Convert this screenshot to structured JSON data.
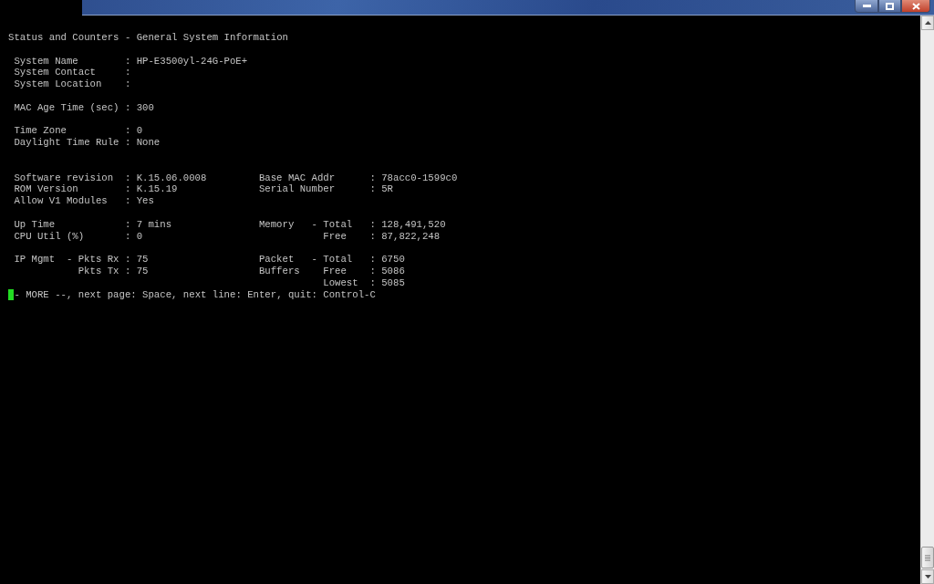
{
  "terminal": {
    "lines": [
      {
        "kind": "heading",
        "text": "Status and Counters - General System Information"
      },
      {
        "kind": "blank"
      },
      {
        "kind": "field",
        "left": {
          "label": "System Name",
          "sep": ":",
          "value": "HP-E3500yl-24G-PoE+"
        }
      },
      {
        "kind": "field",
        "left": {
          "label": "System Contact",
          "sep": ":"
        }
      },
      {
        "kind": "field",
        "left": {
          "label": "System Location",
          "sep": ":"
        }
      },
      {
        "kind": "blank"
      },
      {
        "kind": "field",
        "left": {
          "label": "MAC Age Time (sec)",
          "sep": ":",
          "value": "300"
        }
      },
      {
        "kind": "blank"
      },
      {
        "kind": "field",
        "left": {
          "label": "Time Zone",
          "sep": ":",
          "value": "0"
        }
      },
      {
        "kind": "field",
        "left": {
          "label": "Daylight Time Rule",
          "sep": ":",
          "value": "None"
        }
      },
      {
        "kind": "blank"
      },
      {
        "kind": "blank"
      },
      {
        "kind": "field",
        "left": {
          "label": "Software revision",
          "sep": ":",
          "value": "K.15.06.0008"
        },
        "right": {
          "label": "Base MAC Addr",
          "sep": ":",
          "value": "78acc0-1599c0"
        }
      },
      {
        "kind": "field",
        "left": {
          "label": "ROM Version",
          "sep": ":",
          "value": "K.15.19"
        },
        "right": {
          "label": "Serial Number",
          "sep": ":",
          "value": "5R"
        }
      },
      {
        "kind": "field",
        "left": {
          "label": "Allow V1 Modules",
          "sep": ":",
          "value": "Yes"
        }
      },
      {
        "kind": "blank"
      },
      {
        "kind": "field",
        "left": {
          "label": "Up Time",
          "sep": ":",
          "value": "7 mins"
        },
        "right": {
          "label": "Memory   -",
          "sub": "Total",
          "sep": ":",
          "value": "128,491,520"
        }
      },
      {
        "kind": "field",
        "left": {
          "label": "CPU Util (%)",
          "sep": ":",
          "value": "0"
        },
        "right": {
          "sub": "Free",
          "sep": ":",
          "value": "87,822,248"
        }
      },
      {
        "kind": "blank"
      },
      {
        "kind": "field",
        "left": {
          "label": "IP Mgmt  -",
          "sub": "Pkts Rx",
          "sep": ":",
          "value": "75"
        },
        "right": {
          "label": "Packet   -",
          "sub": "Total",
          "sep": ":",
          "value": "6750"
        }
      },
      {
        "kind": "field",
        "left": {
          "sub": "Pkts Tx",
          "sep": ":",
          "value": "75"
        },
        "right": {
          "label": "Buffers",
          "sub": "Free",
          "sep": ":",
          "value": "5086"
        }
      },
      {
        "kind": "field",
        "right": {
          "sub": "Lowest",
          "sep": ":",
          "value": "5085"
        }
      },
      {
        "kind": "prompt",
        "text": "- MORE --, next page: Space, next line: Enter, quit: Control-C"
      }
    ]
  }
}
